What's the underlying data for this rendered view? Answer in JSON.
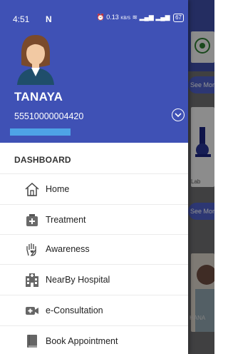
{
  "status_bar": {
    "time": "4:51",
    "notification_glyph": "N",
    "network_speed": "0.13",
    "network_unit": "KB/S",
    "battery": "67"
  },
  "header": {
    "user_name": "TANAYA",
    "user_id": "55510000004420",
    "background_color": "#3f51b5"
  },
  "menu": {
    "section_label": "DASHBOARD",
    "items": [
      {
        "label": "Home",
        "icon": "home-icon"
      },
      {
        "label": "Treatment",
        "icon": "first-aid-kit-icon"
      },
      {
        "label": "Awareness",
        "icon": "hand-heart-icon"
      },
      {
        "label": "NearBy Hospital",
        "icon": "hospital-icon"
      },
      {
        "label": "e-Consultation",
        "icon": "video-call-icon"
      },
      {
        "label": "Book Appointment",
        "icon": "book-icon"
      }
    ]
  },
  "background_app": {
    "see_more_1": "See More",
    "see_more_2": "See More",
    "card_label": "Lab",
    "name_fragment": "HANA"
  }
}
